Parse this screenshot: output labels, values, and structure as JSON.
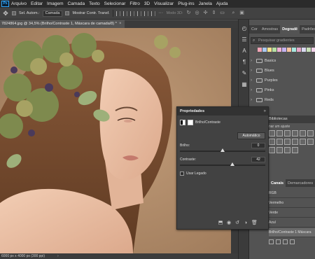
{
  "app": {
    "logo": "Ps"
  },
  "menu": [
    "Arquivo",
    "Editar",
    "Imagem",
    "Camada",
    "Texto",
    "Selecionar",
    "Filtro",
    "3D",
    "Visualizar",
    "Plug-ins",
    "Janela",
    "Ajuda"
  ],
  "options": {
    "auto_select_label": "Sel. Autom.:",
    "layer_select": "Camada",
    "transform_label": "Mostrar Contr. Transf.",
    "mode3d_label": "Modo 3D:"
  },
  "document": {
    "tab_title": "7824864.jpg @ 34,5% (Brilho/Contraste 1, Máscara de camada/8) *",
    "close_glyph": "×",
    "status_text": "6000 px x 4000 px (300 ppi)",
    "status_arrow": "›"
  },
  "right_panel": {
    "tabs": [
      "Cor",
      "Amostras",
      "Degradê",
      "Padrões"
    ],
    "active_tab": "Degradê",
    "search_placeholder": "Pesquisar gradientes",
    "swatch_colors": [
      "#f4a6b7",
      "#a9c8f0",
      "#f9e38c",
      "#b5e0a4",
      "#f2b0d6",
      "#c4b2f0",
      "#f8c4a0",
      "#a8e8e0",
      "#e8a8c8",
      "#d8d8f0",
      "#c8e0b8",
      "#f0d0e8"
    ],
    "folders": [
      "Basics",
      "Blues",
      "Purples",
      "Pinks",
      "Reds"
    ],
    "libraries_label": "Bibliotecas",
    "adjust_label": "nar um ajuste",
    "layers_tabs": [
      "Canais",
      "Demarcadores"
    ],
    "layers": [
      "RGB",
      "Vermelho",
      "Verde",
      "Azul",
      "Brilho/Contraste 1 Máscara"
    ]
  },
  "properties": {
    "title": "Propriedades",
    "close_glyph": "»",
    "layer_name": "Brilho/Contraste",
    "auto_button": "Automático",
    "brightness_label": "Brilho:",
    "brightness_value": "0",
    "brightness_min": -150,
    "brightness_max": 150,
    "contrast_label": "Contraste:",
    "contrast_value": "42",
    "contrast_min": -50,
    "contrast_max": 100,
    "legacy_label": "Usar Legado"
  },
  "colors": {
    "canvas_bg": "#b08b69",
    "panel_bg": "#535353",
    "menubar_bg": "#2b2b2b",
    "accent": "#31a8ff"
  }
}
